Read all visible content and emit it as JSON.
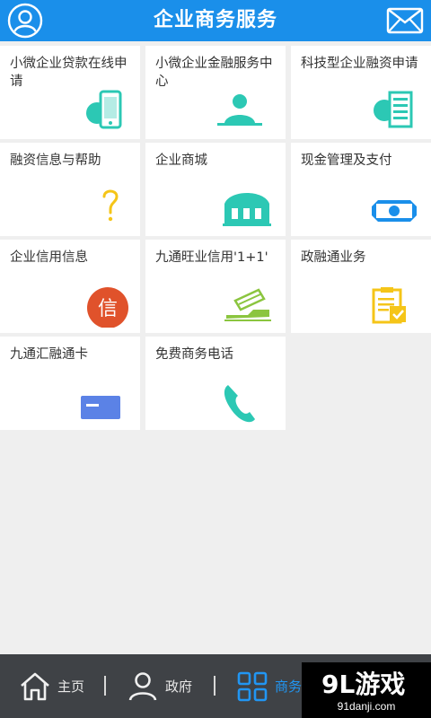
{
  "header": {
    "title": "企业商务服务"
  },
  "tiles": [
    {
      "label": "小微企业贷款在线申请",
      "icon": "mobile-phone-icon"
    },
    {
      "label": "小微企业金融服务中心",
      "icon": "person-icon"
    },
    {
      "label": "科技型企业融资申请",
      "icon": "document-list-icon"
    },
    {
      "label": "融资信息与帮助",
      "icon": "question-mark-icon"
    },
    {
      "label": "企业商城",
      "icon": "shop-icon"
    },
    {
      "label": "现金管理及支付",
      "icon": "banknote-icon"
    },
    {
      "label": "企业信用信息",
      "icon": "credit-badge-icon",
      "glyph": "信"
    },
    {
      "label": "九通旺业信用'1+1'",
      "icon": "card-swipe-icon"
    },
    {
      "label": "政融通业务",
      "icon": "clipboard-check-icon"
    },
    {
      "label": "九通汇融通卡",
      "icon": "bank-card-icon"
    },
    {
      "label": "免费商务电话",
      "icon": "phone-icon"
    }
  ],
  "bottom_nav": [
    {
      "label": "主页",
      "icon": "home-icon"
    },
    {
      "label": "政府",
      "icon": "person-outline-icon"
    },
    {
      "label": "商务",
      "icon": "grid-icon",
      "active": true
    }
  ],
  "watermark": {
    "logo": "9L游戏",
    "url": "91danji.com"
  },
  "colors": {
    "header": "#1a8fea",
    "teal": "#2cc8b4",
    "yellow": "#f5c518",
    "red": "#e0522b",
    "blue_card": "#5b82e6",
    "nav_bg": "#3f4246",
    "nav_active": "#2196f3"
  }
}
